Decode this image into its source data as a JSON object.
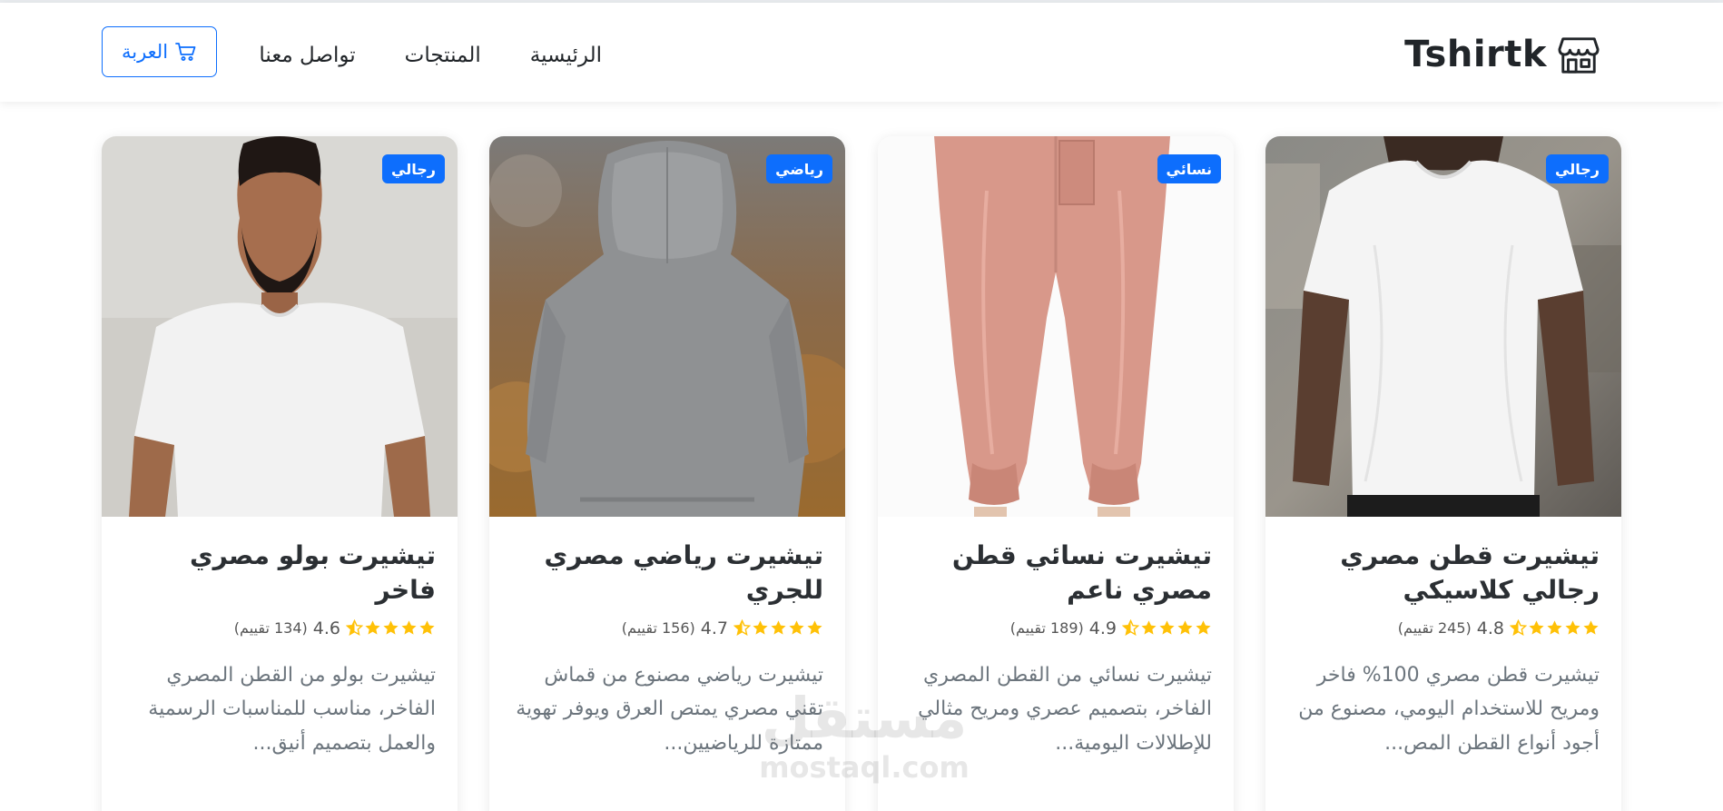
{
  "navbar": {
    "brand": "Tshirtk",
    "brand_icon": "store-icon",
    "links": [
      "الرئيسية",
      "المنتجات",
      "تواصل معنا"
    ],
    "cart_label": "العربة",
    "cart_icon": "cart-icon"
  },
  "accent_color": "#0d6efd",
  "products": [
    {
      "category": "رجالي",
      "title": "تيشيرت قطن مصري رجالي كلاسيكي",
      "rating": "4.8",
      "reviews": "(245 تقييم)",
      "description": "تيشيرت قطن مصري 100% فاخر ومريح للاستخدام اليومي، مصنوع من أجود أنواع القطن المص...",
      "image": "white-tshirt-man-photo"
    },
    {
      "category": "نسائي",
      "title": "تيشيرت نسائي قطن مصري ناعم",
      "rating": "4.9",
      "reviews": "(189 تقييم)",
      "description": "تيشيرت نسائي من القطن المصري الفاخر، بتصميم عصري ومريح مثالي للإطلالات اليومية...",
      "image": "pink-joggers-photo"
    },
    {
      "category": "رياضي",
      "title": "تيشيرت رياضي مصري للجري",
      "rating": "4.7",
      "reviews": "(156 تقييم)",
      "description": "تيشيرت رياضي مصنوع من قماش تقني مصري يمتص العرق ويوفر تهوية ممتازة للرياضيين...",
      "image": "grey-hoodie-photo"
    },
    {
      "category": "رجالي",
      "title": "تيشيرت بولو مصري فاخر",
      "rating": "4.6",
      "reviews": "(134 تقييم)",
      "description": "تيشيرت بولو من القطن المصري الفاخر، مناسب للمناسبات الرسمية والعمل بتصميم أنيق...",
      "image": "bearded-man-tshirt-photo"
    }
  ],
  "watermark": {
    "arabic": "مستقل",
    "latin": "mostaql.com"
  }
}
